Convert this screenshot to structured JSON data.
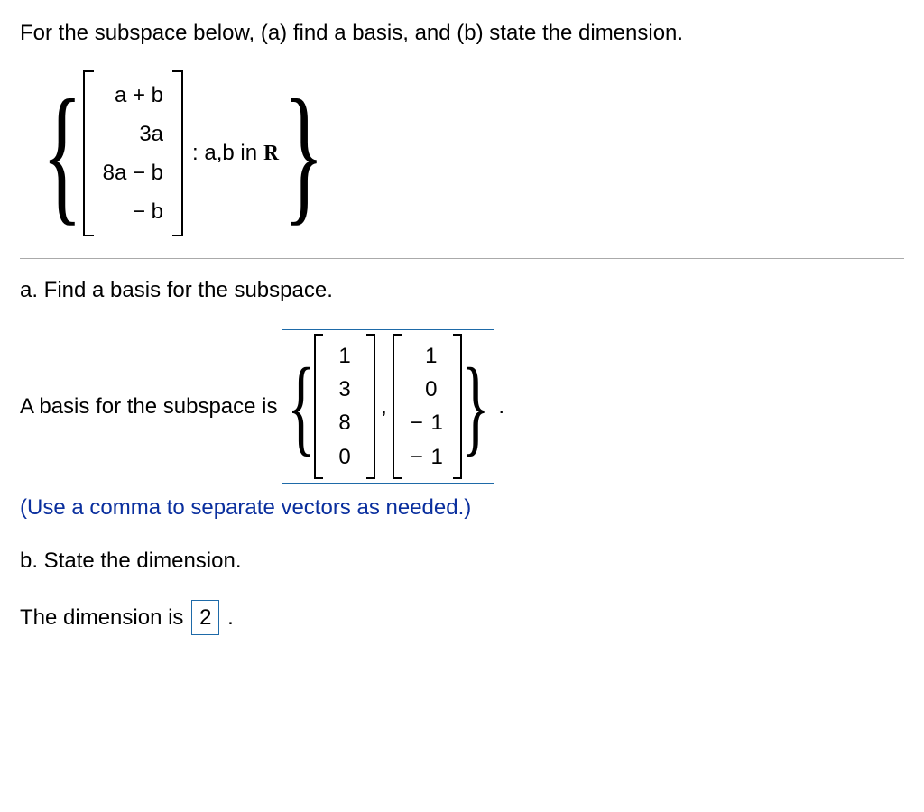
{
  "question": "For the subspace below, (a) find a basis, and (b) state the dimension.",
  "subspace_vector": [
    "a + b",
    "3a",
    "8a − b",
    "− b"
  ],
  "condition_prefix": ": a,b in ",
  "condition_set_symbol": "R",
  "part_a": {
    "prompt": "a. Find a basis for the subspace.",
    "lead": "A basis for the subspace is ",
    "basis_vectors": [
      [
        "1",
        "3",
        "8",
        "0"
      ],
      [
        "1",
        "0",
        "− 1",
        "− 1"
      ]
    ],
    "hint": "(Use a comma to separate vectors as needed.)"
  },
  "part_b": {
    "prompt": "b. State the dimension.",
    "lead": "The dimension is ",
    "value": "2",
    "trail": "."
  },
  "chart_data": {
    "type": "table",
    "description": "Linear-algebra homework item: subspace of R^4, basis and dimension",
    "subspace_generic_vector": {
      "entries": [
        "a+b",
        "3a",
        "8a-b",
        "-b"
      ],
      "parameters": [
        "a",
        "b"
      ],
      "parameter_domain": "R"
    },
    "answer_basis": [
      [
        1,
        3,
        8,
        0
      ],
      [
        1,
        0,
        -1,
        -1
      ]
    ],
    "answer_dimension": 2
  }
}
